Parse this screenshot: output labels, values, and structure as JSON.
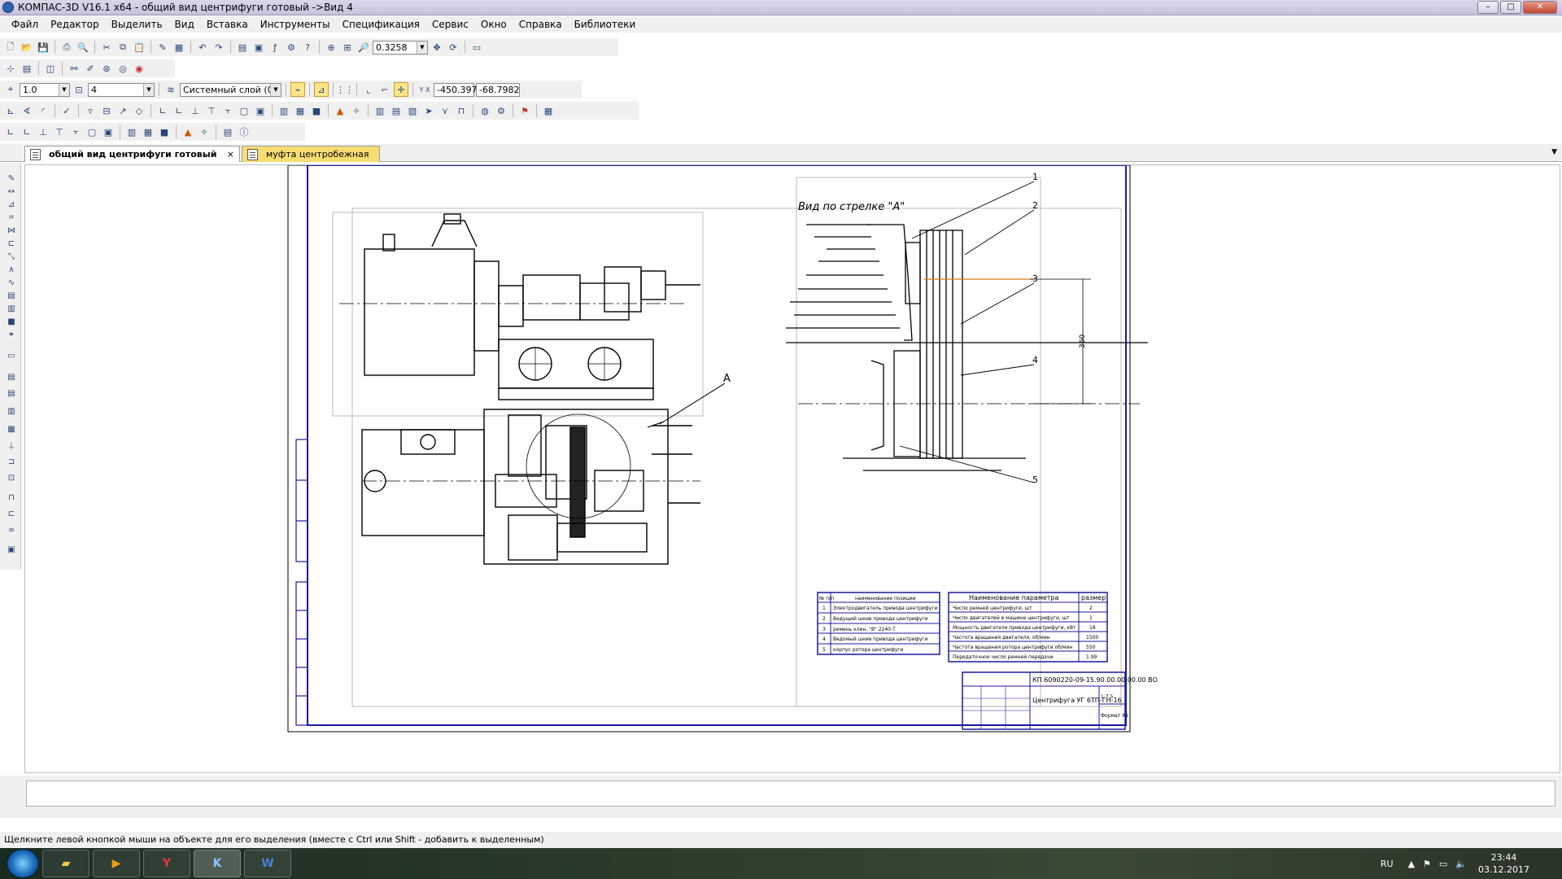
{
  "window": {
    "title": "КОМПАС-3D V16.1 x64 - общий вид центрифуги готовый ->Вид 4",
    "minimize": "–",
    "maximize": "□",
    "close": "✕"
  },
  "menu": [
    "Файл",
    "Редактор",
    "Выделить",
    "Вид",
    "Вставка",
    "Инструменты",
    "Спецификация",
    "Сервис",
    "Окно",
    "Справка",
    "Библиотеки"
  ],
  "toolbar": {
    "zoom": "0.3258",
    "scale": "1.0",
    "step": "4",
    "layer": "Системный слой (0)",
    "coord_x": "-450.397",
    "coord_y": "-68.7982",
    "coord_label": "Y X"
  },
  "tabs": [
    {
      "label": "общий вид центрифуги готовый",
      "close": "×"
    },
    {
      "label": "муфта центробежная"
    }
  ],
  "drawing": {
    "view_label": "Вид по стрелке \"А\"",
    "arrow_label": "А",
    "callouts": [
      "1",
      "2",
      "3",
      "4",
      "5"
    ],
    "dimension": "360",
    "spec_table": {
      "headers": [
        "№ п/п",
        "наименование позиции"
      ],
      "rows": [
        [
          "1",
          "Электродвигатель привода центрифуги"
        ],
        [
          "2",
          "Ведущий шкив привода центрифуги"
        ],
        [
          "3",
          "ремень клин. \"В\" 2240-Т"
        ],
        [
          "4",
          "Ведомый шкив привода центрифуги"
        ],
        [
          "5",
          "корпус ротора центрифуги"
        ]
      ]
    },
    "params_table": {
      "headers": [
        "Наименование параметра",
        "размер"
      ],
      "rows": [
        [
          "Число ремней центрифуги, шт",
          "2"
        ],
        [
          "Число двигателей в машине центрифуги, шт",
          "1"
        ],
        [
          "Мощность двигателя привода центрифуги, кВт",
          "18"
        ],
        [
          "Частота вращения двигателя, об/мин",
          "1500"
        ],
        [
          "Частота вращения ротора центрифуги об/мин",
          "550"
        ],
        [
          "Передаточное число ремней передачи",
          "1.99"
        ]
      ]
    },
    "title_block": {
      "doc_code": "КП 6090220-09-15.90.00.00.00.00 ВО",
      "name": "Центрифуга УГ 6ТП-ГН-16",
      "scale": "1:7.5",
      "material": "Формат А1"
    }
  },
  "status_text": "Щелкните левой кнопкой мыши на объекте для его выделения (вместе с Ctrl или Shift - добавить к выделенным)",
  "tray": {
    "lang": "RU",
    "time": "23:44",
    "date": "03.12.2017"
  },
  "colors": {
    "frame_blue": "#1a1aa0",
    "drawing_line": "#000000",
    "active_tab": "#f7dc72"
  }
}
